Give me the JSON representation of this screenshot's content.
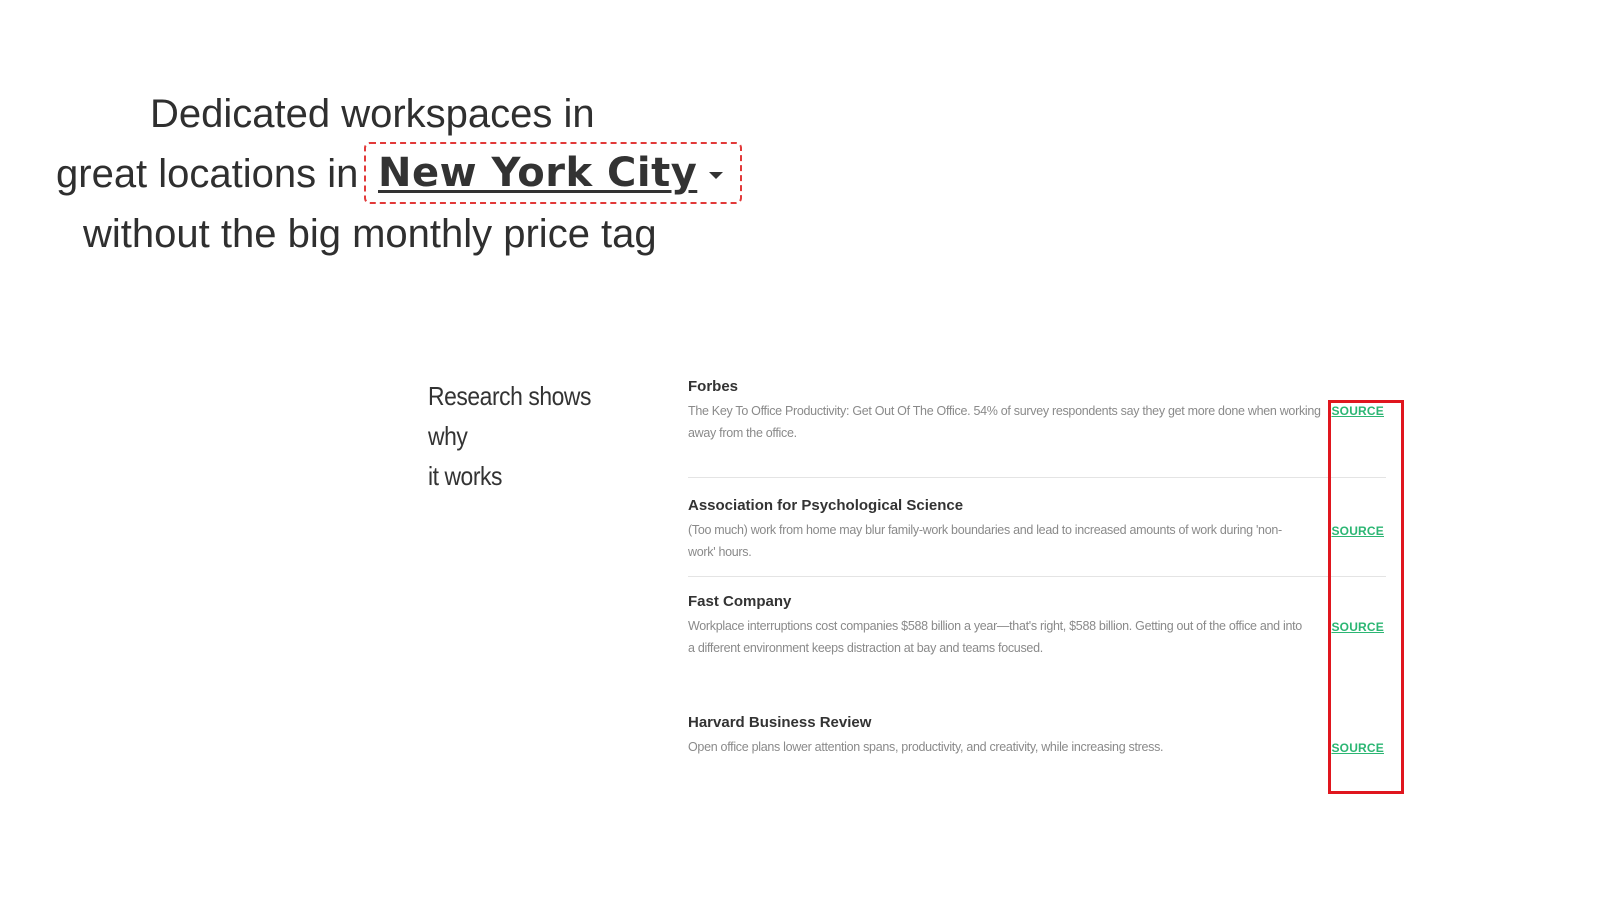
{
  "hero": {
    "line1": "Dedicated workspaces in",
    "line2_prefix": "great locations in",
    "city": "New York City",
    "line3": "without the big monthly price tag"
  },
  "research": {
    "heading_line1": "Research shows why",
    "heading_line2": "it works",
    "items": [
      {
        "name": "Forbes",
        "description": "The Key To Office Productivity: Get Out Of The Office. 54% of survey respondents say they get more done when working away from the office.",
        "link": "SOURCE"
      },
      {
        "name": "Association for Psychological Science",
        "description": "(Too much) work from home may blur family-work boundaries and lead to increased amounts of work during 'non-work' hours.",
        "link": "SOURCE"
      },
      {
        "name": "Fast Company",
        "description": "Workplace interruptions cost companies $588 billion a year—that's right, $588 billion. Getting out of the office and into a different environment keeps distraction at bay and teams focused.",
        "link": "SOURCE"
      },
      {
        "name": "Harvard Business Review",
        "description": "Open office plans lower attention spans, productivity, and creativity, while increasing stress.",
        "link": "SOURCE"
      }
    ]
  },
  "colors": {
    "highlight": "#e0161e",
    "link": "#2bb673",
    "dropdown_outline": "#e23a3a"
  }
}
